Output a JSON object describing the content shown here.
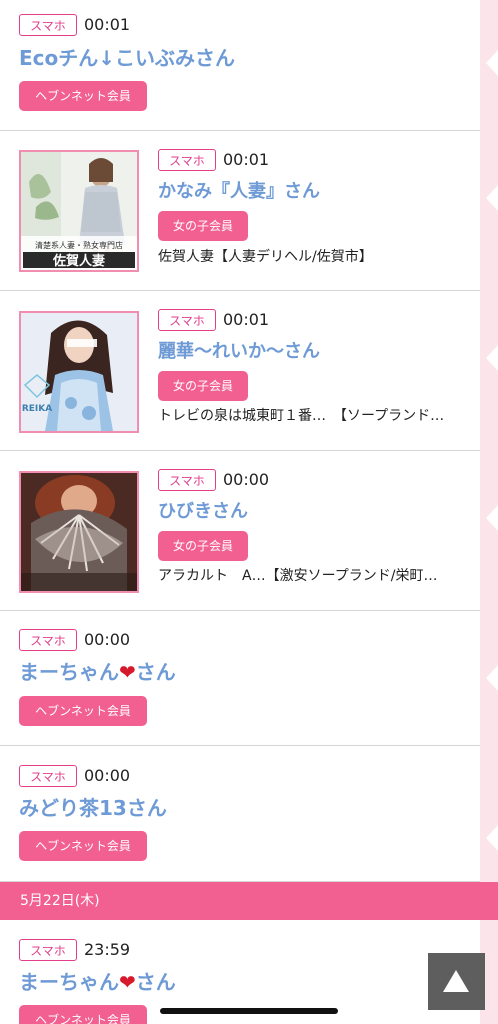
{
  "entries": [
    {
      "tag": "スマホ",
      "time": "00:01",
      "name": "Ecoチん↓こいぶみさん",
      "member": "ヘブンネット会員",
      "shop": ""
    },
    {
      "tag": "スマホ",
      "time": "00:01",
      "name": "かなみ『人妻』さん",
      "member": "女の子会員",
      "shop": "佐賀人妻【人妻デリヘル/佐賀市】",
      "thumb_text": [
        "清楚系人妻・熟女専門店",
        "佐賀人妻"
      ]
    },
    {
      "tag": "スマホ",
      "time": "00:01",
      "name": "麗華〜れいか〜さん",
      "member": "女の子会員",
      "shop": "トレビの泉は城東町１番…　【ソープランド…",
      "thumb_text": [
        "REIKA"
      ]
    },
    {
      "tag": "スマホ",
      "time": "00:00",
      "name": "ひびきさん",
      "member": "女の子会員",
      "shop": "アラカルト　A…【激安ソープランド/栄町…"
    },
    {
      "tag": "スマホ",
      "time": "00:00",
      "name_pre": "まーちゃん",
      "name_heart": "❤",
      "name_post": "さん",
      "member": "ヘブンネット会員"
    },
    {
      "tag": "スマホ",
      "time": "00:00",
      "name": "みどり茶13さん",
      "member": "ヘブンネット会員"
    },
    {
      "tag": "スマホ",
      "time": "23:59",
      "name_pre": "まーちゃん",
      "name_heart": "❤",
      "name_post": "さん",
      "member": "ヘブンネット会員"
    }
  ],
  "date_header": "5月22日(木)",
  "colors": {
    "accent_pink": "#f25f91",
    "tag_pink": "#e23e8a",
    "name_blue": "#6e9ad6",
    "deco_pink": "#fbe4ea"
  },
  "icons": {
    "scroll_top": "up-triangle-icon"
  }
}
